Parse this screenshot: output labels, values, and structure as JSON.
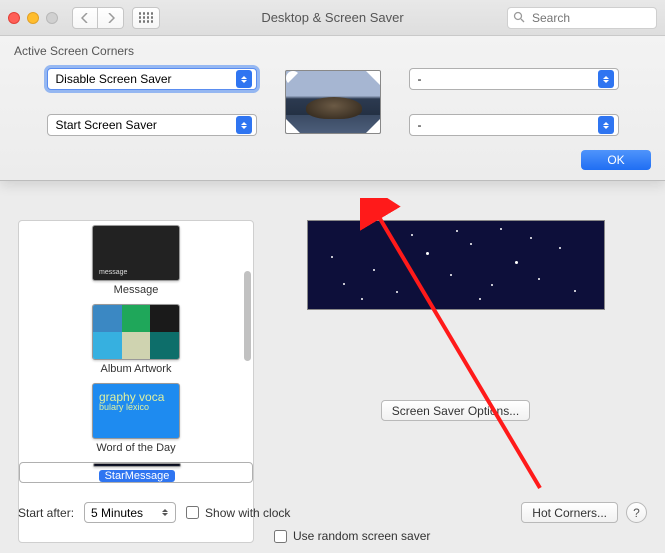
{
  "titlebar": {
    "title": "Desktop & Screen Saver",
    "search_placeholder": "Search"
  },
  "sheet": {
    "header": "Active Screen Corners",
    "corners": {
      "top_left": "Disable Screen Saver",
      "bottom_left": "Start Screen Saver",
      "top_right": "-",
      "bottom_right": "-"
    },
    "ok": "OK"
  },
  "savers": {
    "message": "Message",
    "album": "Album Artwork",
    "word": "Word of the Day",
    "star": "StarMessage"
  },
  "word_thumb": {
    "l1": "graphy voca",
    "l2": "bulary lexico"
  },
  "options": {
    "button": "Screen Saver Options..."
  },
  "bottom": {
    "start_label": "Start after:",
    "start_value": "5 Minutes",
    "show_clock": "Show with clock",
    "random": "Use random screen saver",
    "hot_corners": "Hot Corners...",
    "help": "?"
  }
}
